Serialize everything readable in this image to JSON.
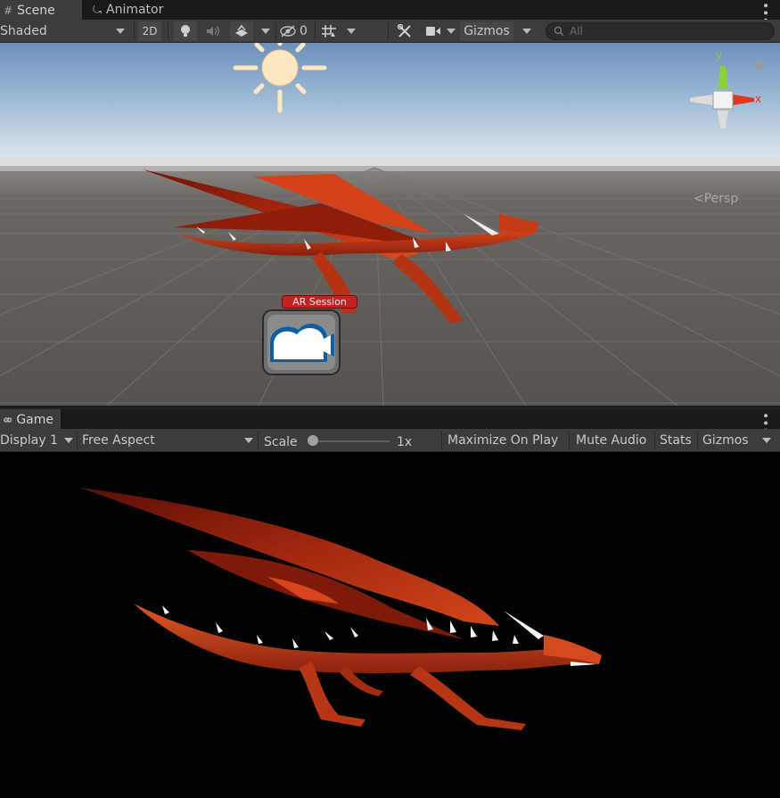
{
  "scene_tabs": [
    {
      "label": "Scene",
      "icon": "hash-icon"
    },
    {
      "label": "Animator",
      "icon": "animator-icon"
    }
  ],
  "scene_toolbar": {
    "shading_mode": "Shaded",
    "two_d_label": "2D",
    "hidden_count": "0",
    "gizmos_label": "Gizmos",
    "search_placeholder": "All"
  },
  "scene_view": {
    "projection_label": "Persp",
    "axis_y": "y",
    "axis_x": "x",
    "ar_session_label": "AR Session"
  },
  "game_tab": {
    "label": "Game",
    "icon": "gamepad-icon"
  },
  "game_toolbar": {
    "display": "Display 1",
    "aspect": "Free Aspect",
    "scale_label": "Scale",
    "scale_value": "1x",
    "scale_fraction": 0.0,
    "maximize_label": "Maximize On Play",
    "mute_label": "Mute Audio",
    "stats_label": "Stats",
    "gizmos_label": "Gizmos"
  },
  "colors": {
    "accent_red": "#c62121",
    "axis_y_green": "#8bd13a",
    "axis_x_red": "#e0361f",
    "sky_top": "#6f92bf",
    "ground": "#5f5a57"
  }
}
